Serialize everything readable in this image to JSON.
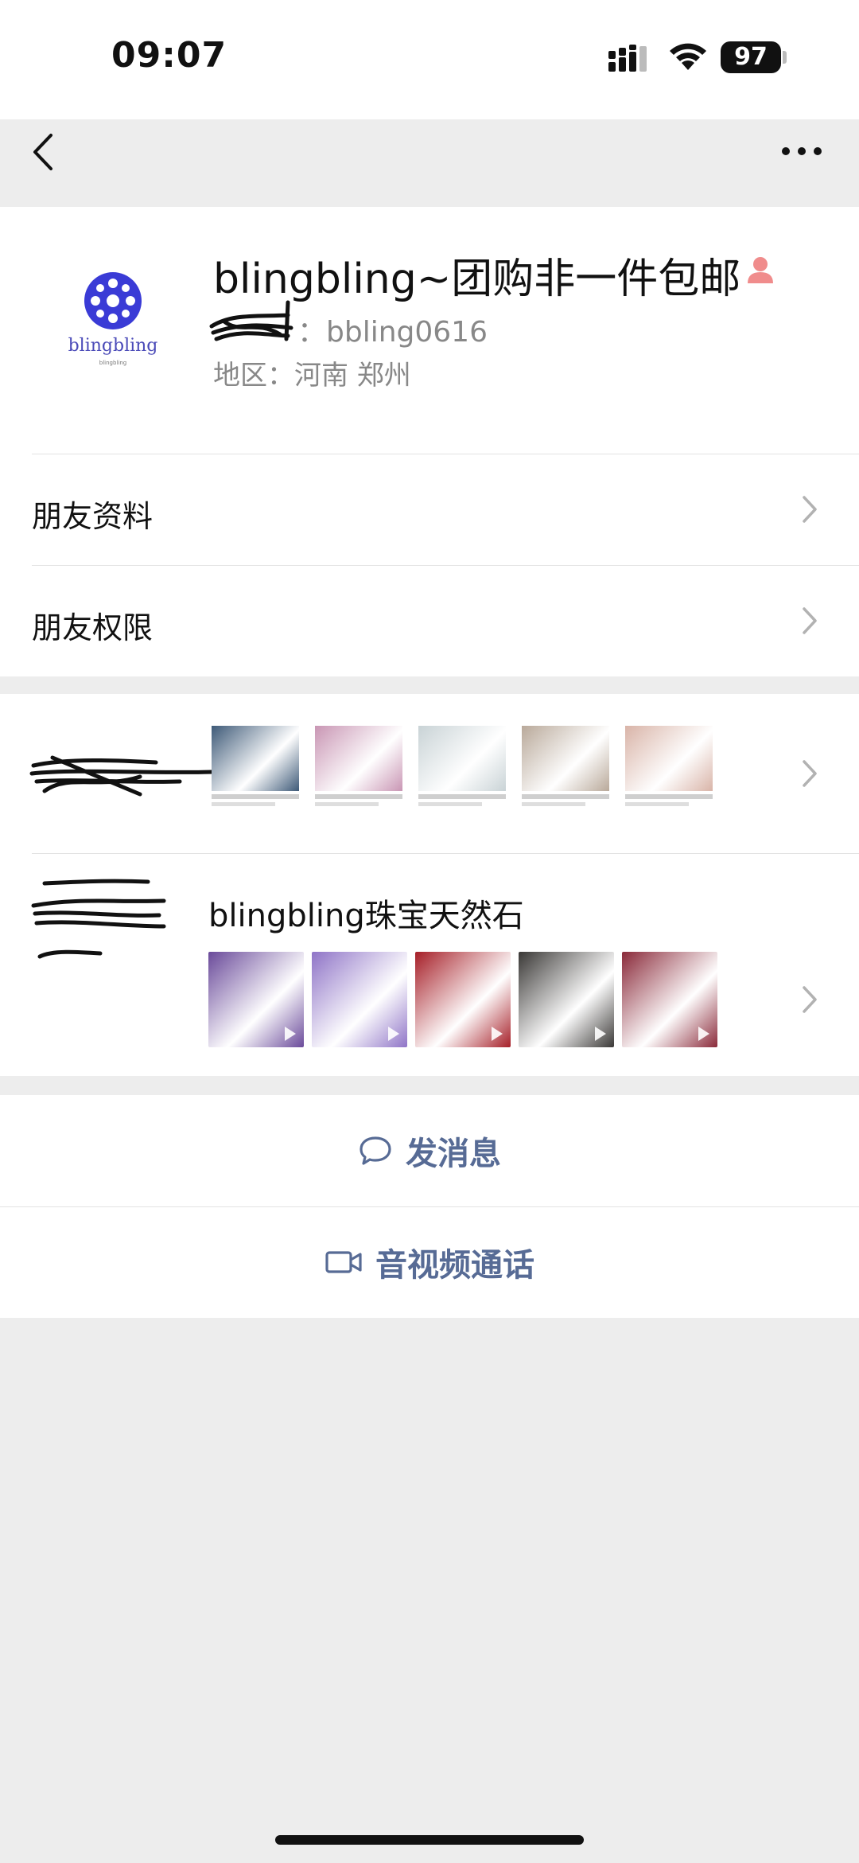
{
  "status_bar": {
    "time": "09:07",
    "battery": "97"
  },
  "profile": {
    "avatar_brand": "blingbling",
    "avatar_sub": "blingbling",
    "name": "blingbling~团购非一件包邮",
    "wechat_id": "：bbling0616",
    "region": "地区：河南 郑州"
  },
  "rows": {
    "friend_info": "朋友资料",
    "friend_permissions": "朋友权限"
  },
  "moments": {
    "thumb_colors": [
      "#3e5a78",
      "#c996b4",
      "#c9d3d6",
      "#b9a99a",
      "#d9b4a8"
    ]
  },
  "channels": {
    "name": "blingbling珠宝天然石",
    "thumb_colors": [
      "#6a4a9a",
      "#8f74c7",
      "#a61f28",
      "#3a3836",
      "#8a2a3a"
    ]
  },
  "actions": {
    "message": "发消息",
    "call": "音视频通话"
  },
  "colors": {
    "link": "#576b95",
    "background": "#ededed"
  }
}
